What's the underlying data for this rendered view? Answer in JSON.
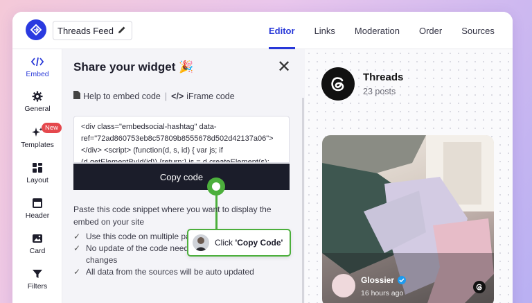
{
  "header": {
    "feed_title": "Threads Feed",
    "tabs": [
      {
        "label": "Editor"
      },
      {
        "label": "Links"
      },
      {
        "label": "Moderation"
      },
      {
        "label": "Order"
      },
      {
        "label": "Sources"
      }
    ],
    "active_tab": "Editor"
  },
  "sidebar": {
    "items": [
      {
        "label": "Embed",
        "icon": "code-icon"
      },
      {
        "label": "General",
        "icon": "gear-icon"
      },
      {
        "label": "Templates",
        "icon": "sparkle-icon",
        "badge": "New"
      },
      {
        "label": "Layout",
        "icon": "grid-icon"
      },
      {
        "label": "Header",
        "icon": "header-icon"
      },
      {
        "label": "Card",
        "icon": "image-icon"
      },
      {
        "label": "Filters",
        "icon": "filter-icon"
      }
    ]
  },
  "panel": {
    "title": "Share your widget 🎉",
    "help_link": "Help to embed code",
    "iframe_link": "iFrame code",
    "code": "<div class=\"embedsocial-hashtag\" data-ref=\"72ad860753eb8c57809b8555678d502d42137a06\"></div> <script> (function(d, s, id) { var js; if (d.getElementById(id)) {return;} js = d.createElement(s); js.id = id; js.src = \"https://embedsocial.",
    "copy_button": "Copy code",
    "instructions": "Paste this code snippet where you want to display the embed on your site",
    "checklist": [
      "Use this code on multiple pages: mobile and desktop",
      "No update of the code needed after making design changes",
      "All data from the sources will be auto updated"
    ],
    "tooltip_prefix": "Click ",
    "tooltip_action": "'Copy Code'"
  },
  "preview": {
    "feed_name": "Threads",
    "post_count": "23 posts",
    "card": {
      "author": "Glossier",
      "time": "16 hours ago"
    }
  },
  "colors": {
    "accent": "#2838d8",
    "highlight_green": "#4caf3c",
    "badge_red": "#e5484d",
    "dark_button": "#1b1d2a"
  }
}
